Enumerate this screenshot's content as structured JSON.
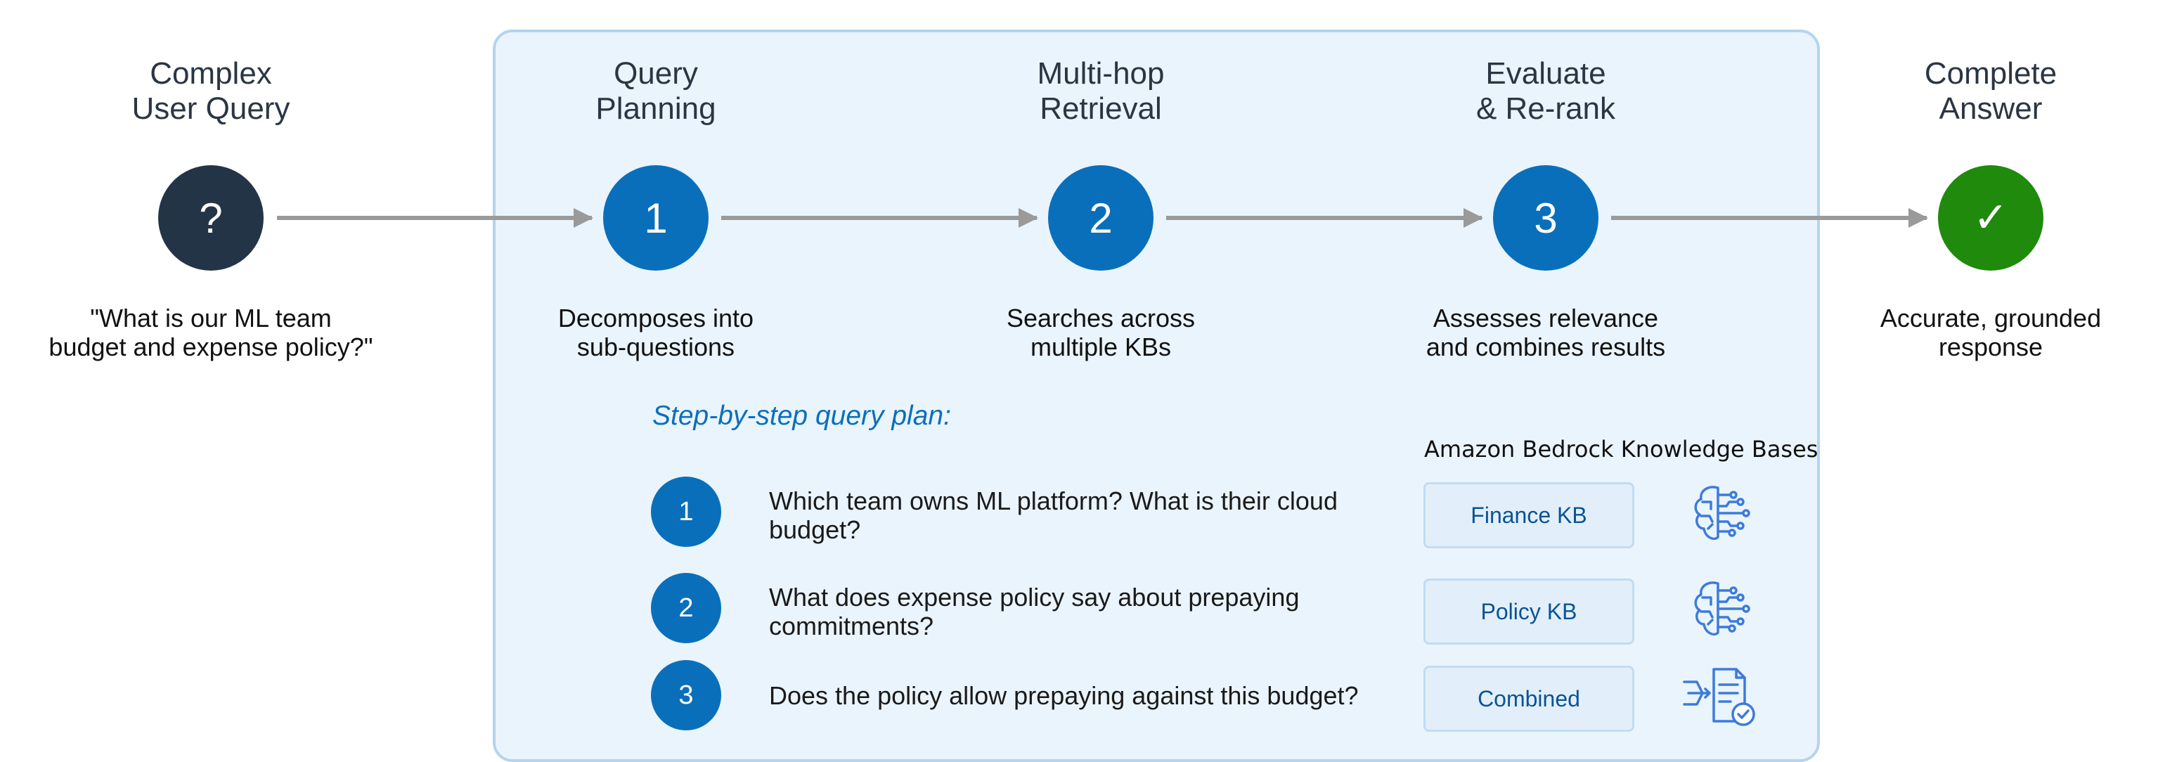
{
  "stages": [
    {
      "title": "Complex\nUser Query",
      "symbol": "?",
      "description": "\"What is our ML team\nbudget and expense policy?\""
    },
    {
      "title": "Query\nPlanning",
      "symbol": "1",
      "description": "Decomposes into\nsub-questions"
    },
    {
      "title": "Multi-hop\nRetrieval",
      "symbol": "2",
      "description": "Searches across\nmultiple KBs"
    },
    {
      "title": "Evaluate\n& Re-rank",
      "symbol": "3",
      "description": "Assesses relevance\nand combines results"
    },
    {
      "title": "Complete\nAnswer",
      "symbol": "✓",
      "description": "Accurate, grounded\nresponse"
    }
  ],
  "plan": {
    "title": "Step-by-step query plan:",
    "kb_header": "Amazon Bedrock Knowledge Bases",
    "steps": [
      {
        "number": "1",
        "text": "Which team owns ML platform? What is their cloud budget?",
        "kb": "Finance KB",
        "icon": "brain-circuit-icon"
      },
      {
        "number": "2",
        "text": "What does expense policy say about prepaying commitments?",
        "kb": "Policy KB",
        "icon": "brain-circuit-icon"
      },
      {
        "number": "3",
        "text": "Does the policy allow prepaying against this budget?",
        "kb": "Combined",
        "icon": "document-merge-check-icon"
      }
    ]
  },
  "colors": {
    "panel_bg": "#eaf4fc",
    "panel_border": "#b4d4f0",
    "dark_circle": "#243447",
    "blue_circle": "#0a6fbb",
    "green_circle": "#1f8a0b",
    "arrow": "#9a9a9a",
    "kb_text": "#0b5394"
  }
}
